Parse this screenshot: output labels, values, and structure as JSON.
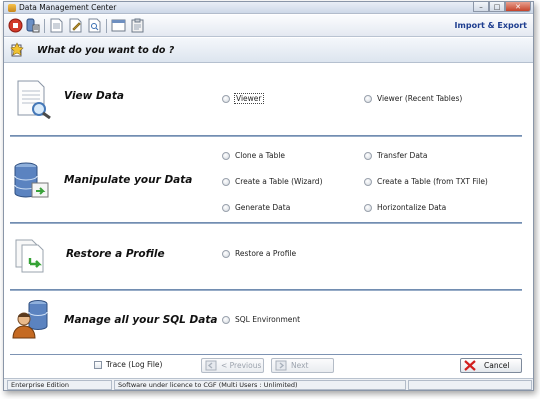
{
  "window": {
    "title": "Data Management Center"
  },
  "toolbar": {
    "import_export": "Import & Export"
  },
  "question": "What do you want to do ?",
  "sections": [
    {
      "title": "View Data",
      "options": [
        "Viewer",
        "Viewer (Recent Tables)"
      ]
    },
    {
      "title": "Manipulate your Data",
      "options": [
        "Clone a Table",
        "Transfer Data",
        "Create a Table (Wizard)",
        "Create a Table (from TXT File)",
        "Generate Data",
        "Horizontalize Data"
      ]
    },
    {
      "title": "Restore a Profile",
      "options": [
        "Restore a Profile"
      ]
    },
    {
      "title": "Manage all your SQL Data",
      "options": [
        "SQL Environment"
      ]
    }
  ],
  "footer": {
    "trace_label": "Trace (Log File)",
    "previous_label": "< Previous",
    "next_label": "Next",
    "cancel_label": "Cancel"
  },
  "status": {
    "edition": "Enterprise Edition",
    "licence": "Software under licence to CGF (Multi Users : Unlimited)"
  },
  "colors": {
    "accent": "#1d3d8f",
    "divider": "#5f7ea6"
  },
  "icons": {
    "window": "app-icon",
    "question": "wizard-icon",
    "view": "document-magnifier-icon",
    "manipulate": "database-arrow-icon",
    "restore": "documents-arrow-icon",
    "manage": "user-database-icon"
  }
}
